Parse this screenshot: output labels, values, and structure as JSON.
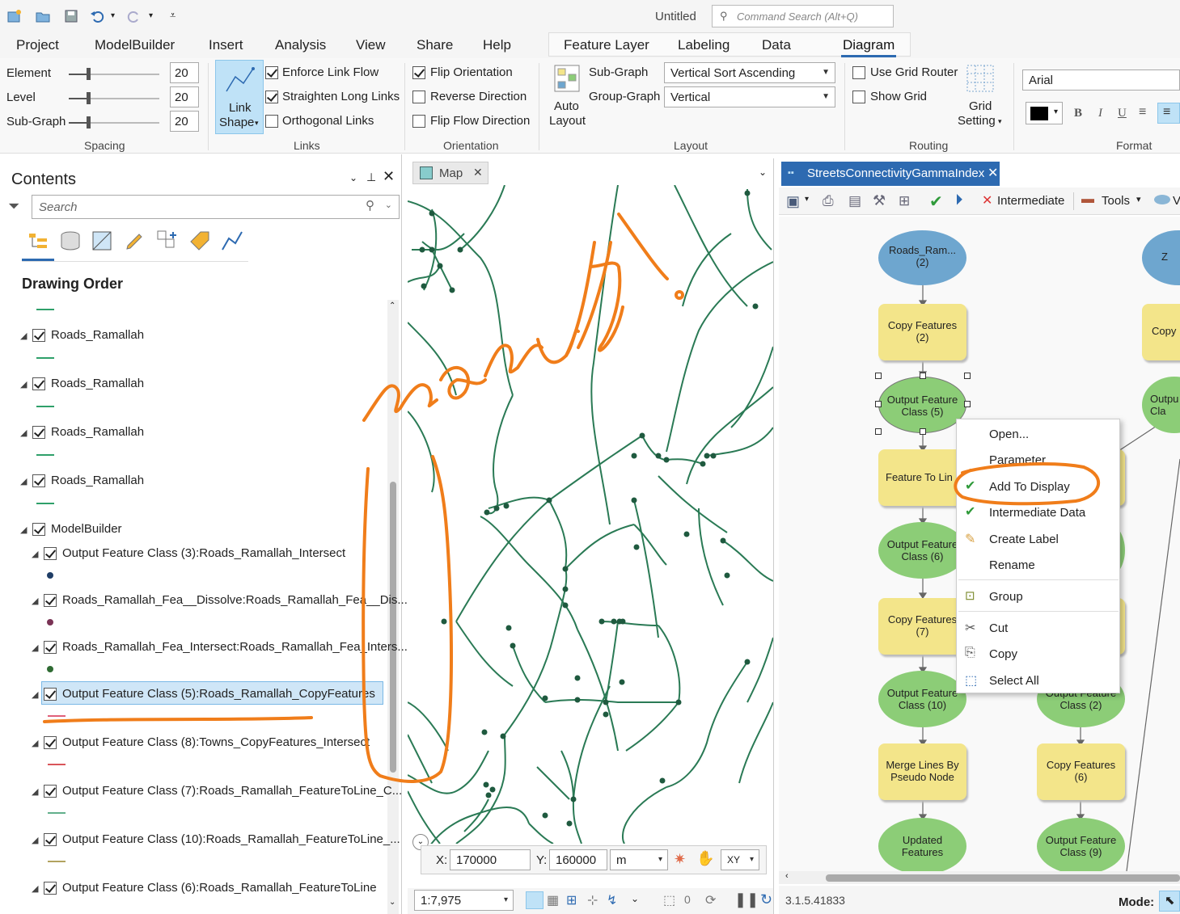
{
  "app": {
    "title": "Untitled",
    "command_search_placeholder": "Command Search (Alt+Q)"
  },
  "ribbon_tabs": [
    "Project",
    "ModelBuilder",
    "Insert",
    "Analysis",
    "View",
    "Share",
    "Help",
    "Feature Layer",
    "Labeling",
    "Data",
    "Diagram"
  ],
  "active_tab": "Diagram",
  "spacing": {
    "element_label": "Element",
    "element_value": "20",
    "level_label": "Level",
    "level_value": "20",
    "subgraph_label": "Sub-Graph",
    "subgraph_value": "20",
    "group_label": "Spacing"
  },
  "links": {
    "link_shape_label": "Link",
    "link_shape_label2": "Shape",
    "enforce_link_flow": "Enforce Link Flow",
    "straighten_long_links": "Straighten Long Links",
    "orthogonal_links": "Orthogonal Links",
    "group_label": "Links"
  },
  "orientation": {
    "flip_orientation": "Flip Orientation",
    "reverse_direction": "Reverse Direction",
    "flip_flow_direction": "Flip Flow Direction",
    "group_label": "Orientation"
  },
  "layout": {
    "auto_layout": "Auto",
    "auto_layout2": "Layout",
    "sub_graph_label": "Sub-Graph",
    "sub_graph_value": "Vertical Sort Ascending",
    "group_graph_label": "Group-Graph",
    "group_graph_value": "Vertical",
    "group_label": "Layout"
  },
  "routing": {
    "use_grid_router": "Use Grid Router",
    "show_grid": "Show Grid",
    "grid_setting": "Grid",
    "grid_setting2": "Setting",
    "group_label": "Routing"
  },
  "format": {
    "font": "Arial",
    "bold": "B",
    "italic": "I",
    "underline": "U",
    "group_label": "Format",
    "color": "#000000"
  },
  "contents": {
    "title": "Contents",
    "search_placeholder": "Search",
    "drawing_order": "Drawing Order",
    "layers": [
      "Roads_Ramallah",
      "Roads_Ramallah",
      "Roads_Ramallah",
      "Roads_Ramallah",
      "ModelBuilder",
      "Output Feature Class (3):Roads_Ramallah_Intersect",
      "Roads_Ramallah_Fea__Dissolve:Roads_Ramallah_Fea__Dis...",
      "Roads_Ramallah_Fea_Intersect:Roads_Ramallah_Fea_Inters...",
      "Output Feature Class (5):Roads_Ramallah_CopyFeatures",
      "Output Feature Class (8):Towns_CopyFeatures_Intersect",
      "Output Feature Class (7):Roads_Ramallah_FeatureToLine_C...",
      "Output Feature Class (10):Roads_Ramallah_FeatureToLine_...",
      "Output Feature Class (6):Roads_Ramallah_FeatureToLine"
    ],
    "selected_layer_index": 8
  },
  "map": {
    "tab_label": "Map",
    "x_label": "X:",
    "x_value": "170000",
    "y_label": "Y:",
    "y_value": "160000",
    "unit": "m",
    "xy_label": "XY",
    "scale": "1:7,975",
    "selection_count": "0",
    "road_color": "#2a7a55"
  },
  "modelbuilder": {
    "tab_label": "StreetsConnectivityGammaIndex",
    "intermediate": "Intermediate",
    "tools": "Tools",
    "version": "3.1.5.41833",
    "mode_label": "Mode:",
    "nodes": {
      "roads_ram": "Roads_Ram...\n(2)",
      "copy_features_2": "Copy Features\n(2)",
      "output_fc_5": "Output Feature\nClass (5)",
      "feature_to_line": "Feature To Lin",
      "output_fc_6": "Output Feature\nClass (6)",
      "copy_features_7": "Copy Features\n(7)",
      "output_fc_10": "Output Feature\nClass (10)",
      "merge_lines": "Merge Lines By\nPseudo Node",
      "updated_features": "Updated\nFeatures",
      "output_fc_2": "Output Feature\nClass (2)",
      "copy_features_6": "Copy Features\n(6)",
      "output_fc_9": "Output Feature\nClass (9)",
      "z_partial": "Z",
      "copy_partial": "Copy",
      "outpu_partial": "Outpu\nCla"
    }
  },
  "context_menu": {
    "items": [
      "Open...",
      "Parameter",
      "Add To Display",
      "Intermediate Data",
      "Create Label",
      "Rename",
      "Group",
      "Cut",
      "Copy",
      "Select All"
    ],
    "checked": [
      "Add To Display",
      "Intermediate Data"
    ]
  },
  "annotation": {
    "handwritten_text": "manually !",
    "ink_color": "#f07d1a"
  }
}
